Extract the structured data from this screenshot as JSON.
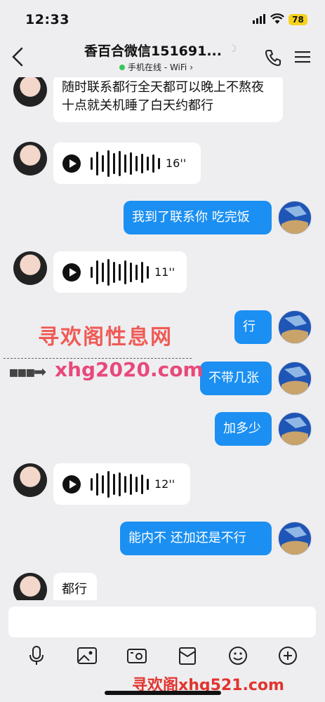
{
  "status": {
    "time": "12:33",
    "battery": "78"
  },
  "header": {
    "title": "香百合微信151691...",
    "subtitle": "手机在线 - WiFi"
  },
  "messages": [
    {
      "side": "in",
      "type": "text",
      "text": "随时联系都行全天都可以晚上不熬夜十点就关机睡了白天约都行"
    },
    {
      "side": "in",
      "type": "voice",
      "duration": "16''"
    },
    {
      "side": "out",
      "type": "text",
      "text": "我到了联系你 吃完饭"
    },
    {
      "side": "in",
      "type": "voice",
      "duration": "11''"
    },
    {
      "side": "out",
      "type": "text",
      "text": "行"
    },
    {
      "side": "out",
      "type": "text",
      "text": "不带几张"
    },
    {
      "side": "out",
      "type": "text",
      "text": "加多少"
    },
    {
      "side": "in",
      "type": "voice",
      "duration": "12''"
    },
    {
      "side": "out",
      "type": "text",
      "text": "能内不  还加还是不行"
    },
    {
      "side": "in",
      "type": "text",
      "text": "都行"
    }
  ],
  "watermarks": {
    "site_name": "寻欢阁性息网",
    "site_url": "xhg2020.com",
    "footer": "寻欢阁xhg521.com"
  },
  "toolbar": [
    "mic-icon",
    "image-icon",
    "camera-icon",
    "gift-icon",
    "emoji-icon",
    "plus-icon"
  ],
  "colors": {
    "accent": "#1b8ff2",
    "online": "#35c759",
    "battery": "#f7d21c"
  }
}
